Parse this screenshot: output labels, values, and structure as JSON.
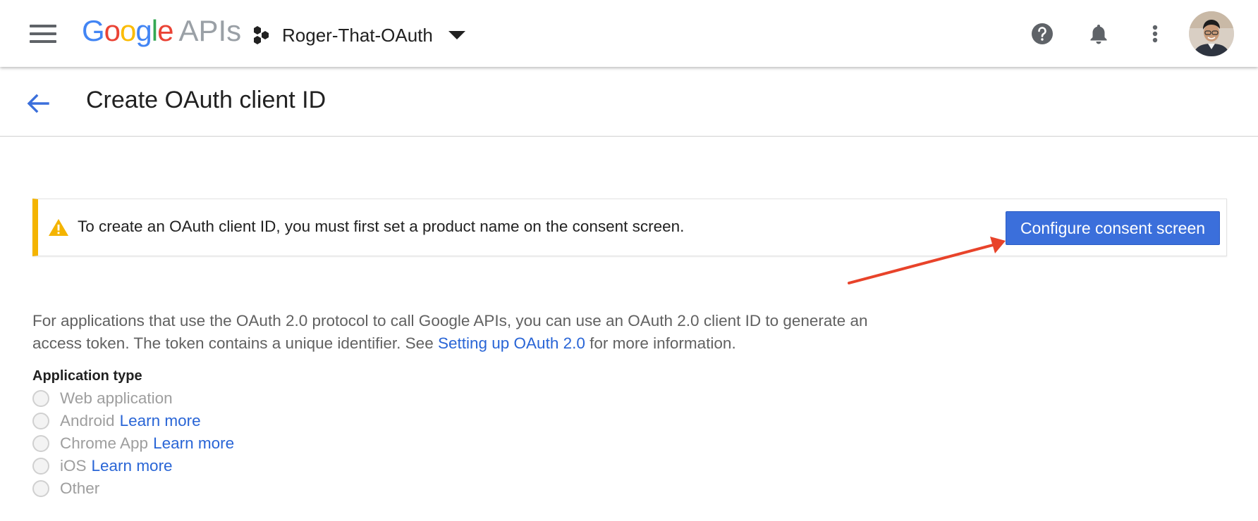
{
  "topbar": {
    "logo_g": [
      "G",
      "o",
      "o",
      "g",
      "l",
      "e"
    ],
    "logo_apis": "APIs",
    "project_name": "Roger-That-OAuth"
  },
  "header": {
    "title": "Create OAuth client ID"
  },
  "alert": {
    "message": "To create an OAuth client ID, you must first set a product name on the consent screen.",
    "button_label": "Configure consent screen"
  },
  "description": {
    "text_before": "For applications that use the OAuth 2.0 protocol to call Google APIs, you can use an OAuth 2.0 client ID to generate an access token. The token contains a unique identifier. See ",
    "link_text": "Setting up OAuth 2.0",
    "text_after": " for more information."
  },
  "application_type": {
    "label": "Application type",
    "options": [
      {
        "label": "Web application",
        "link": ""
      },
      {
        "label": "Android",
        "link": "Learn more"
      },
      {
        "label": "Chrome App",
        "link": "Learn more"
      },
      {
        "label": "iOS",
        "link": "Learn more"
      },
      {
        "label": "Other",
        "link": ""
      }
    ]
  },
  "colors": {
    "primary_button": "#3b6fdb",
    "link": "#2965d6",
    "warning": "#f4b400",
    "annotation_arrow": "#e8432a"
  },
  "icons": {
    "menu": "hamburger-menu-icon",
    "project": "hexagon-cluster-icon",
    "help": "help-icon",
    "notifications": "bell-icon",
    "more": "more-vert-icon",
    "back": "arrow-back-icon",
    "warning": "warning-triangle-icon"
  }
}
